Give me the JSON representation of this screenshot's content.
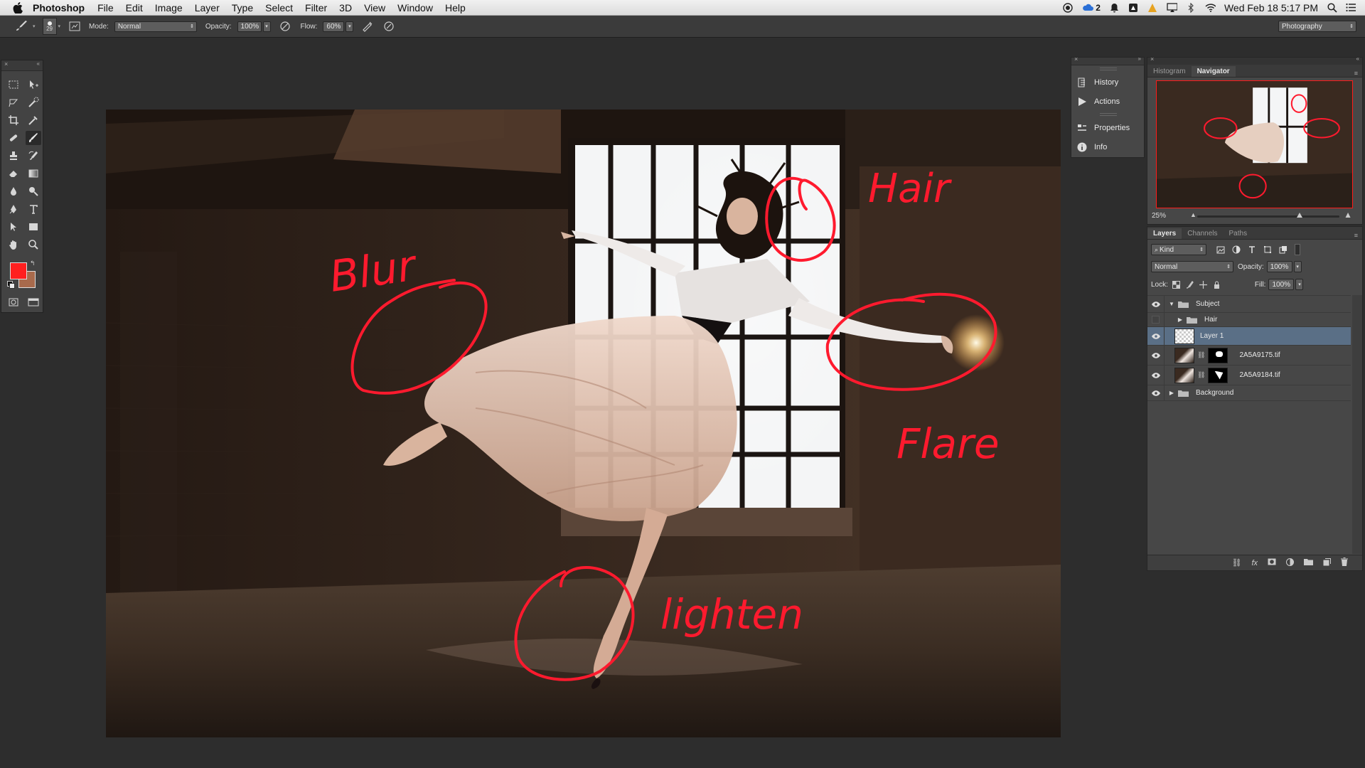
{
  "menubar": {
    "app_name": "Photoshop",
    "menus": [
      "File",
      "Edit",
      "Image",
      "Layer",
      "Type",
      "Select",
      "Filter",
      "3D",
      "View",
      "Window",
      "Help"
    ],
    "status": {
      "cc_count": "2",
      "datetime": "Wed Feb 18  5:17 PM",
      "icons": [
        "record-icon",
        "creative-cloud-icon",
        "notification-bell-icon",
        "sketch-icon",
        "adobe-alert-icon",
        "airplay-icon",
        "bluetooth-icon",
        "wifi-icon",
        "spotlight-search-icon",
        "notification-center-icon"
      ]
    }
  },
  "options_bar": {
    "brush_size": "29",
    "mode_label": "Mode:",
    "mode_value": "Normal",
    "opacity_label": "Opacity:",
    "opacity_value": "100%",
    "flow_label": "Flow:",
    "flow_value": "60%",
    "workspace": "Photography"
  },
  "tools": {
    "foreground_color": "#ff1f1f",
    "background_color": "#a86a4c",
    "items": [
      "rectangular-marquee",
      "move",
      "lasso",
      "quick-selection",
      "crop",
      "eyedropper",
      "healing-brush",
      "brush",
      "clone-stamp",
      "history-brush",
      "eraser",
      "gradient",
      "blur",
      "dodge",
      "pen",
      "type",
      "path-selection",
      "rectangle",
      "hand",
      "zoom"
    ]
  },
  "dock": {
    "items": [
      {
        "label": "History",
        "icon": "history-icon"
      },
      {
        "label": "Actions",
        "icon": "actions-play-icon"
      },
      {
        "label": "Properties",
        "icon": "properties-icon"
      },
      {
        "label": "Info",
        "icon": "info-icon"
      }
    ]
  },
  "navigator": {
    "tabs": [
      "Histogram",
      "Navigator"
    ],
    "active_tab": "Navigator",
    "zoom": "25%",
    "zoom_level": 0.72
  },
  "layers": {
    "tabs": [
      "Layers",
      "Channels",
      "Paths"
    ],
    "active_tab": "Layers",
    "filter_kind": "Kind",
    "blend_mode": "Normal",
    "opacity_label": "Opacity:",
    "opacity_value": "100%",
    "lock_label": "Lock:",
    "fill_label": "Fill:",
    "fill_value": "100%",
    "rows": [
      {
        "name": "Subject",
        "type": "group",
        "visible": true,
        "expanded": true
      },
      {
        "name": "Hair",
        "type": "group",
        "visible": false,
        "expanded": false
      },
      {
        "name": "Layer 1",
        "type": "layer",
        "visible": true,
        "selected": true
      },
      {
        "name": "2A5A9175.tif",
        "type": "layer-mask",
        "visible": true
      },
      {
        "name": "2A5A9184.tif",
        "type": "layer-mask",
        "visible": true
      },
      {
        "name": "Background",
        "type": "group",
        "visible": true,
        "expanded": false
      }
    ]
  },
  "canvas": {
    "annotation_color": "#ff1a2e",
    "annotations": [
      "Blur",
      "Hair",
      "Flare",
      "lighten"
    ]
  }
}
